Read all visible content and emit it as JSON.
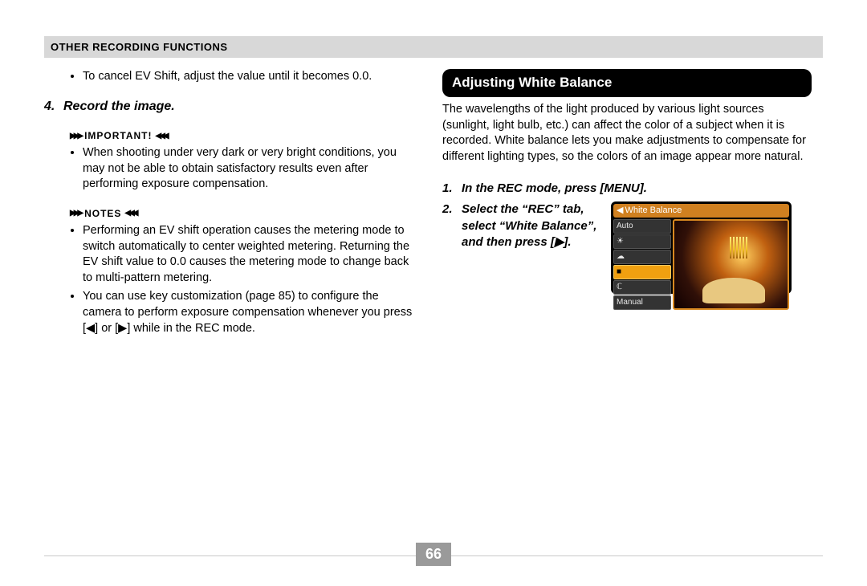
{
  "header": "Other Recording Functions",
  "left": {
    "bullet_cancel": "To cancel EV Shift, adjust the value until it becomes 0.0.",
    "step4_num": "4.",
    "step4_text": "Record the image.",
    "important_label": "IMPORTANT!",
    "important_bullets": [
      "When shooting under very dark or very bright conditions, you may not be able to obtain satisfactory results even after performing exposure compensation."
    ],
    "notes_label": "NOTES",
    "notes_bullets": [
      "Performing an EV shift operation causes the metering mode to switch automatically to center weighted metering. Returning the EV shift value to 0.0 causes the metering mode to change back to multi-pattern metering.",
      "You can use key customization (page 85) to configure the camera to perform exposure compensation whenever you press [◀] or [▶] while in the REC mode."
    ]
  },
  "right": {
    "section_title": "Adjusting White Balance",
    "intro": "The wavelengths of the light produced by various light sources (sunlight, light bulb, etc.) can affect the color of a subject when it is recorded. White balance lets you make adjustments to compensate for different lighting types, so the colors of an image appear more natural.",
    "step1_num": "1.",
    "step1_text": "In the REC mode, press [MENU].",
    "step2_num": "2.",
    "step2_text": "Select the “REC” tab, select “White Balance”, and then press [▶].",
    "lcd": {
      "title": "White Balance",
      "items": [
        "Auto",
        "☀",
        "☁",
        "■",
        "ℂ",
        "Manual"
      ],
      "selected_index": 3
    }
  },
  "page_number": "66"
}
